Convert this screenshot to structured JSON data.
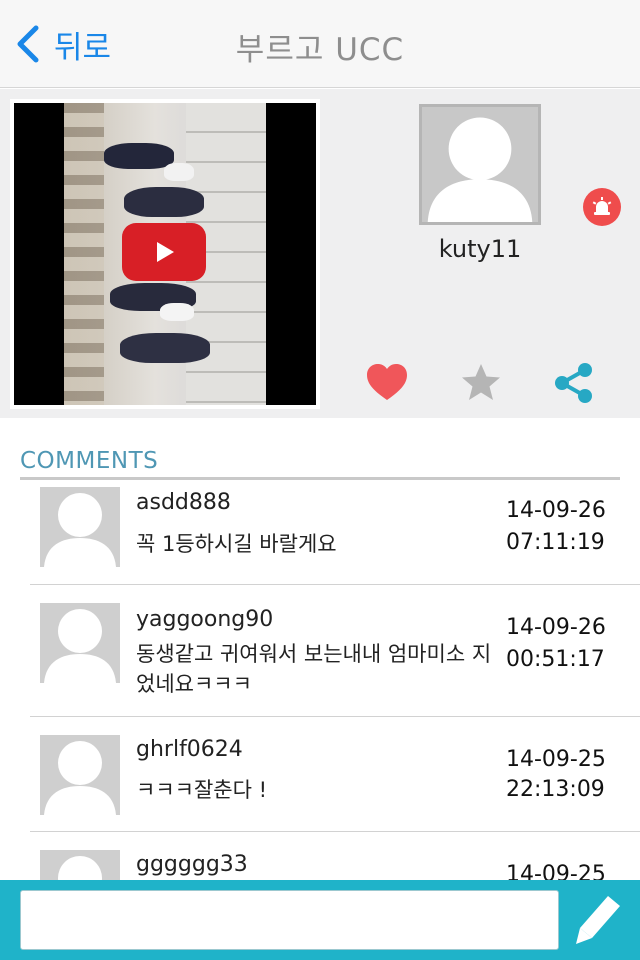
{
  "navbar": {
    "back_label": "뒤로",
    "title": "부르고 UCC"
  },
  "profile": {
    "username": "kuty11"
  },
  "actions": [
    "heart-icon",
    "star-icon",
    "share-icon"
  ],
  "comments": {
    "title": "COMMENTS",
    "items": [
      {
        "user": "asdd888",
        "text": "꼭 1등하시길 바랄게요",
        "date": "14-09-26",
        "time": "07:11:19"
      },
      {
        "user": "yaggoong90",
        "text": "동생같고 귀여워서 보는내내 엄마미소 지었네요ㅋㅋㅋ",
        "date": "14-09-26",
        "time": "00:51:17"
      },
      {
        "user": "ghrlf0624",
        "text": "ㅋㅋㅋ잘춘다 !",
        "date": "14-09-25",
        "time": "22:13:09"
      },
      {
        "user": "gggggg33",
        "text": "",
        "date": "14-09-25",
        "time": ""
      }
    ]
  },
  "composer": {
    "placeholder": ""
  },
  "colors": {
    "accent_blue": "#1a87e8",
    "comments_title": "#4f97b4",
    "bottom_bar": "#1fb3c9",
    "heart": "#f0565a",
    "star": "#b5b5b5",
    "share": "#27a8c4",
    "report": "#ef4c4c",
    "play_button": "#d81f26"
  }
}
